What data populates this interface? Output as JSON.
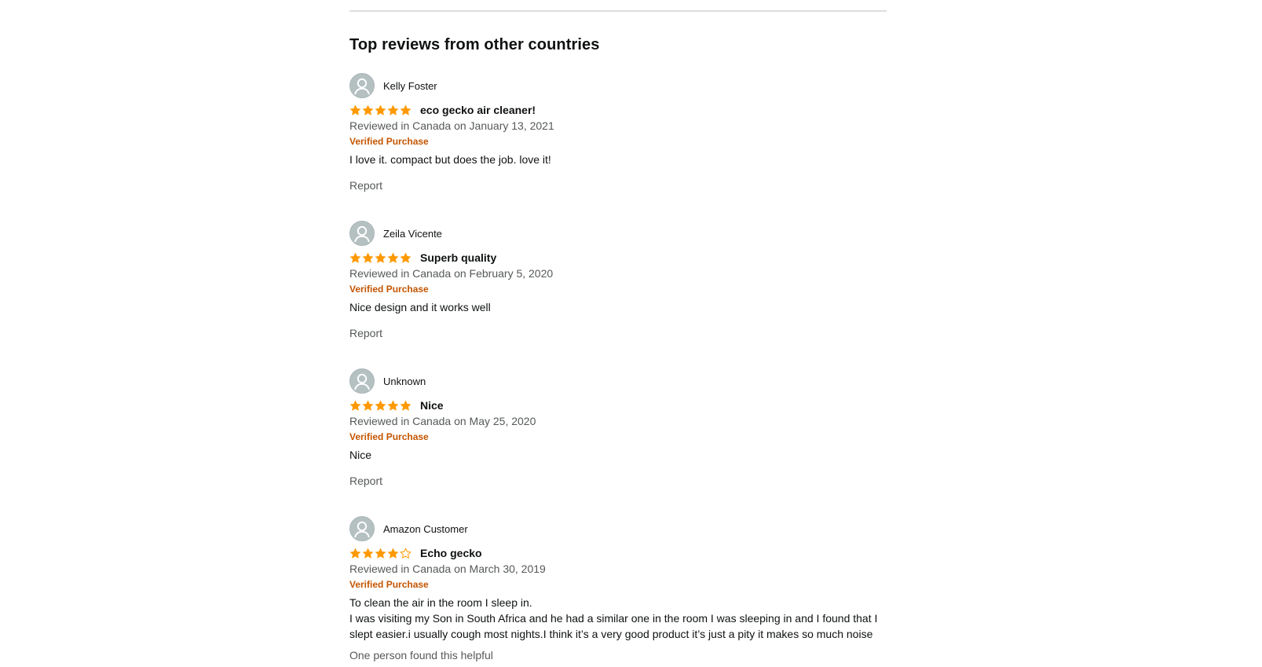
{
  "section_title": "Top reviews from other countries",
  "colors": {
    "star": "#ff9900",
    "verified": "#c45500",
    "muted": "#565959"
  },
  "reviews": [
    {
      "profile_name": "Kelly Foster",
      "rating": 5,
      "title": "eco gecko air cleaner!",
      "date": "Reviewed in Canada on January 13, 2021",
      "verified": "Verified Purchase",
      "body": [
        "I love it. compact but does the job. love it!"
      ],
      "report": "Report"
    },
    {
      "profile_name": "Zeila Vicente",
      "rating": 5,
      "title": "Superb quality",
      "date": "Reviewed in Canada on February 5, 2020",
      "verified": "Verified Purchase",
      "body": [
        "Nice design and it works well"
      ],
      "report": "Report"
    },
    {
      "profile_name": "Unknown",
      "rating": 5,
      "title": "Nice",
      "date": "Reviewed in Canada on May 25, 2020",
      "verified": "Verified Purchase",
      "body": [
        "Nice"
      ],
      "report": "Report"
    },
    {
      "profile_name": "Amazon Customer",
      "rating": 4,
      "title": "Echo gecko",
      "date": "Reviewed in Canada on March 30, 2019",
      "verified": "Verified Purchase",
      "body": [
        "To clean the air in the room I sleep in.",
        "I was visiting my Son in South Africa and he had a similar one in the room I was sleeping in and I found that I slept easier.i usually cough most nights.I think it’s a very good product it’s just a pity it makes so much noise"
      ],
      "helpful": "One person found this helpful"
    }
  ]
}
